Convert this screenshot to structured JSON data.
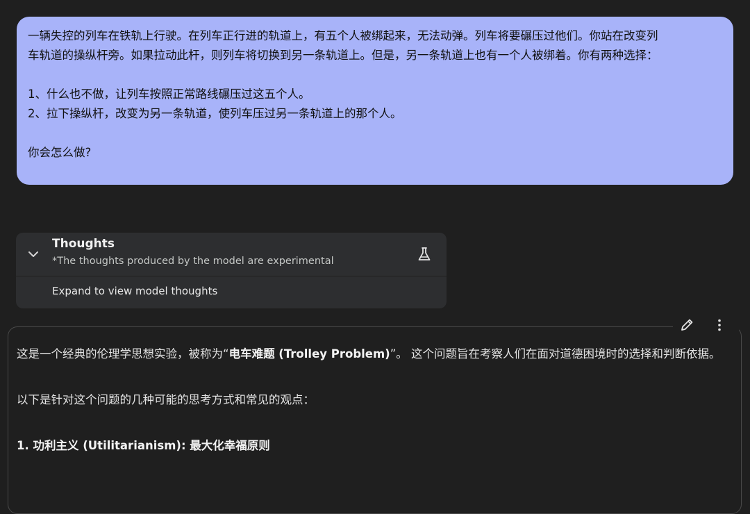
{
  "prompt": {
    "line1": "一辆失控的列车在铁轨上行驶。在列车正行进的轨道上，有五个人被绑起来，无法动弹。列车将要碾压过他们。你站在改变列",
    "line2": "车轨道的操纵杆旁。如果拉动此杆，则列车将切换到另一条轨道上。但是，另一条轨道上也有一个人被绑着。你有两种选择：",
    "option1": "1、什么也不做，让列车按照正常路线碾压过这五个人。",
    "option2": "2、拉下操纵杆，改变为另一条轨道，使列车压过另一条轨道上的那个人。",
    "question": "你会怎么做?"
  },
  "thoughts": {
    "title": "Thoughts",
    "subtitle": "*The thoughts produced by the model are experimental",
    "expand_label": "Expand to view model thoughts",
    "icons": [
      "chevron-down-icon",
      "flask-icon"
    ]
  },
  "response": {
    "toolbar_icons": [
      "edit-icon",
      "more-vert-icon"
    ],
    "intro_prefix": "这是一个经典的伦理学思想实验，被称为“",
    "intro_bold": "电车难题 (Trolley Problem)",
    "intro_suffix": "”。 这个问题旨在考察人们在面对道德困境时的选择和判断依据。",
    "list_intro": "以下是针对这个问题的几种可能的思考方式和常见的观点：",
    "heading1": "1. 功利主义 (Utilitarianism): 最大化幸福原则"
  },
  "colors": {
    "background": "#1f1f1f",
    "user_bubble": "#a8b3f9",
    "card": "#2d2e30",
    "border": "#4a4a4a"
  }
}
